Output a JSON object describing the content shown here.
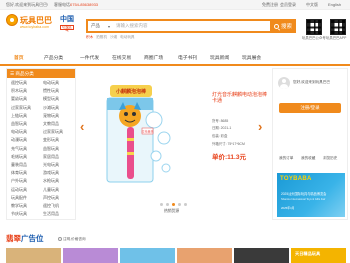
{
  "topbar": {
    "greeting": "您好,欢迎来到玩具巴巴!",
    "phone_label": "客服电话:",
    "phone": "0754-85638933",
    "register": "免费注册",
    "login": "会员登录",
    "chinese": "中文版",
    "english": "English"
  },
  "header": {
    "logo_name": "玩具巴巴",
    "logo_site": "www.toybaba.com",
    "region": "中国",
    "region_sub": "切换区域",
    "search": {
      "category": "产品",
      "placeholder": "请输入搜索内容",
      "button": "搜索"
    },
    "hot_words": [
      "积木",
      "拍照机",
      "沙滩",
      "电动玩具"
    ],
    "qr_labels": [
      "玩具巴巴公众号",
      "玩具巴巴APP"
    ]
  },
  "nav": {
    "items": [
      "首页",
      "产品分类",
      "一件代发",
      "在线交易",
      "商圈广场",
      "电子书刊",
      "玩具新闻",
      "玩具展会"
    ],
    "active": "首页"
  },
  "sidebar": {
    "title": "商品分类",
    "left": [
      "遥控玩具",
      "积木玩具",
      "婴幼玩具",
      "过家家玩具",
      "上链玩具",
      "益智玩具",
      "电动玩具",
      "动漫玩具",
      "充气玩具",
      "毛绒玩具",
      "童装用品",
      "体育玩具",
      "户外玩具",
      "运动玩具",
      "玩具配件",
      "教学玩具",
      "节庆玩具"
    ],
    "right": [
      "电动玩具",
      "惯性玩具",
      "模型玩具",
      "沙滩玩具",
      "宠物玩具",
      "文教用品",
      "过家家玩具",
      "变形玩具",
      "益智玩具",
      "家居用品",
      "光电玩具",
      "游戏玩具",
      "水枪玩具",
      "儿童玩具",
      "声控玩具",
      "遥控飞机",
      "生活用品"
    ]
  },
  "slider": {
    "product_title": "灯光音乐麒麟电动泡泡棒卡通",
    "specs": [
      {
        "label": "货号",
        "value": "8685"
      },
      {
        "label": "日期",
        "value": "2021-1"
      },
      {
        "label": "包装",
        "value": "彩盒"
      },
      {
        "label": "外箱尺寸",
        "value": "75*17*6CM"
      }
    ],
    "price_label": "单价:",
    "price": "11.3元",
    "caption": "热销货源",
    "active_dot": 3,
    "dot_count": 5,
    "box_label": "小麒麟泡泡棒",
    "box_badge": "灯光音乐"
  },
  "panel": {
    "welcome": "您好,欢迎来到玩具巴巴",
    "login_button": "注册/登录",
    "links": [
      "我的订单",
      "我的收藏",
      "浏览历史"
    ],
    "fair": {
      "brand_a": "TOY",
      "brand_b": "BABA",
      "line1": "2025汕头国际玩具与精品博览会",
      "line2": "Shantou International Toys & Gifts Fair",
      "date": "2025年4月"
    }
  },
  "ads": {
    "title_a": "翡翠",
    "title_b": "广告位",
    "note": "注明,价格咨询",
    "items": [
      {
        "label": "",
        "color": "#d9b37a"
      },
      {
        "label": "",
        "color": "#b98bd6"
      },
      {
        "label": "",
        "color": "#6fc1e8"
      },
      {
        "label": "",
        "color": "#e8a26f"
      },
      {
        "label": "",
        "color": "#3a3a3a"
      },
      {
        "label": "天日精品玩具",
        "color": "#f4b400"
      }
    ]
  },
  "colors": {
    "accent": "#f08a1c",
    "price": "#e8431c",
    "brand_blue": "#1f5fb0"
  }
}
